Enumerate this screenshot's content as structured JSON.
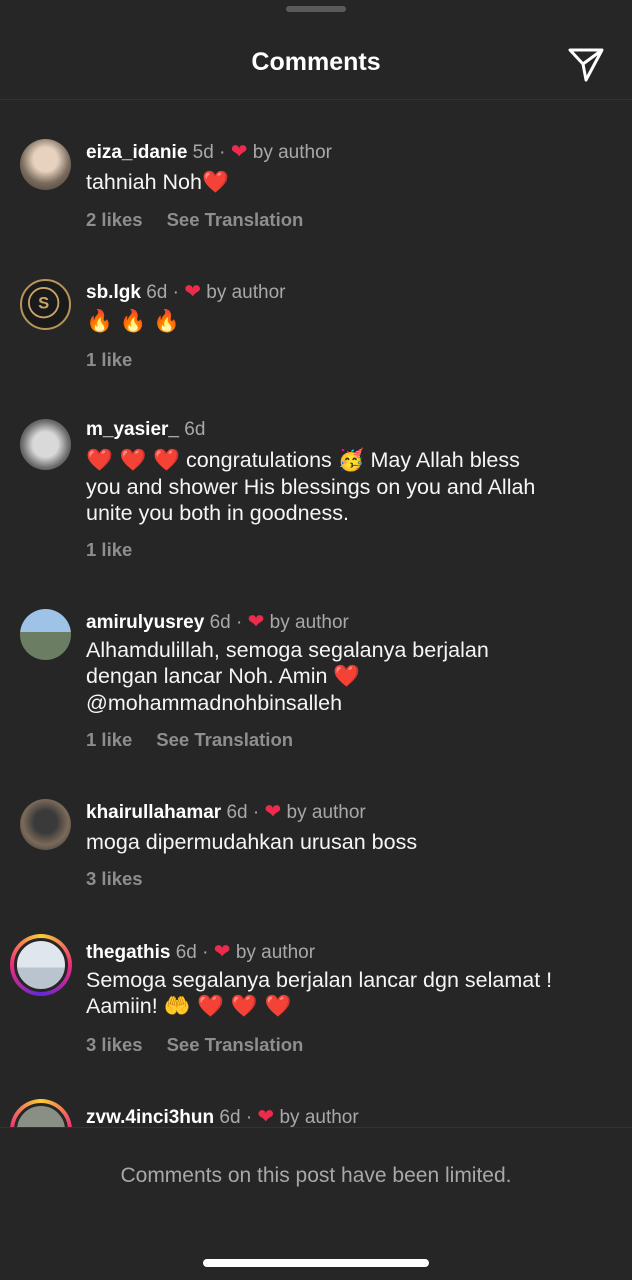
{
  "header": {
    "title": "Comments"
  },
  "comments": [
    {
      "user": "eiza_idanie",
      "time": "5d",
      "dot": "·",
      "liked_by_author": true,
      "by_label": "by author",
      "text": "tahniah Noh",
      "emoji": "❤️",
      "likes": "2 likes",
      "translate": "See Translation"
    },
    {
      "user": "sb.lgk",
      "time": "6d",
      "dot": "·",
      "liked_by_author": true,
      "by_label": "by author",
      "text": "",
      "emoji": "🔥 🔥 🔥",
      "likes": "1 like",
      "translate": ""
    },
    {
      "user": "m_yasier_",
      "time": "6d",
      "dot": "",
      "liked_by_author": false,
      "by_label": "",
      "text_prefix_emoji": "❤️ ❤️ ❤️",
      "text_mid": " congratulations ",
      "mid_emoji": "🥳",
      "text_rest": " May Allah bless you and shower His blessings on you and Allah unite you both in goodness.",
      "likes": "1 like",
      "translate": ""
    },
    {
      "user": "amirulyusrey",
      "time": "6d",
      "dot": "·",
      "liked_by_author": true,
      "by_label": "by author",
      "text": "Alhamdulillah, semoga segalanya berjalan dengan lancar Noh. Amin",
      "emoji": "❤️",
      "mention": "@mohammadnohbinsalleh",
      "likes": "1 like",
      "translate": "See Translation"
    },
    {
      "user": "khairullahamar",
      "time": "6d",
      "dot": "·",
      "liked_by_author": true,
      "by_label": "by author",
      "text": "moga dipermudahkan urusan boss",
      "likes": "3 likes",
      "translate": ""
    },
    {
      "user": "thegathis",
      "time": "6d",
      "dot": "·",
      "liked_by_author": true,
      "by_label": "by author",
      "text": "Semoga segalanya berjalan lancar dgn selamat ! Aamiin!",
      "emoji": "🤲 ❤️ ❤️ ❤️",
      "likes": "3 likes",
      "translate": "See Translation"
    },
    {
      "user": "zvw.4inci3hun",
      "time": "6d",
      "dot": "·",
      "liked_by_author": true,
      "by_label": "by author"
    }
  ],
  "footer": {
    "limited_text": "Comments on this post have been limited."
  },
  "icons": {
    "send": "paper-plane-icon",
    "heart": "heart-icon"
  },
  "colors": {
    "background": "#262626",
    "heart": "#ed2b4d",
    "muted": "#a8a8a8"
  }
}
